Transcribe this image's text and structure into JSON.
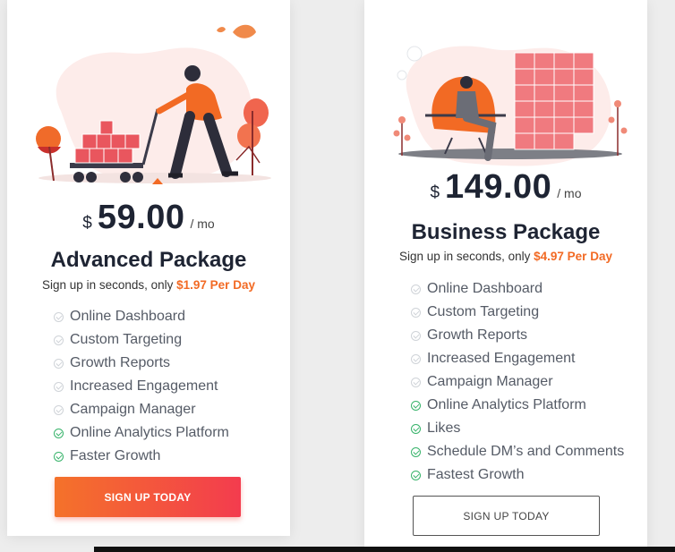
{
  "colors": {
    "accent_orange": "#f26a24",
    "button_gradient_start": "#f4722a",
    "button_gradient_end": "#f33c4e",
    "check_active": "#37b36a",
    "check_inactive": "#cfd3d8",
    "title_dark": "#1e2433"
  },
  "advanced": {
    "illustration": "person-pushing-cart-of-likes-illustration",
    "currency": "$",
    "amount": "59.00",
    "period": "/ mo",
    "title": "Advanced Package",
    "subline_prefix": "Sign up in seconds, only ",
    "subline_highlight": "$1.97 Per Day",
    "features": [
      {
        "label": "Online Dashboard",
        "included": false
      },
      {
        "label": "Custom Targeting",
        "included": false
      },
      {
        "label": "Growth Reports",
        "included": false
      },
      {
        "label": "Increased Engagement",
        "included": false
      },
      {
        "label": "Campaign Manager",
        "included": false
      },
      {
        "label": "Online Analytics Platform",
        "included": true
      },
      {
        "label": "Faster Growth",
        "included": true
      }
    ],
    "button_label": "SIGN UP TODAY"
  },
  "business": {
    "illustration": "person-in-chair-with-follower-stack-illustration",
    "currency": "$",
    "amount": "149.00",
    "period": "/ mo",
    "title": "Business Package",
    "subline_prefix": "Sign up in seconds, only ",
    "subline_highlight": "$4.97 Per Day",
    "features": [
      {
        "label": "Online Dashboard",
        "included": false
      },
      {
        "label": "Custom Targeting",
        "included": false
      },
      {
        "label": "Growth Reports",
        "included": false
      },
      {
        "label": "Increased Engagement",
        "included": false
      },
      {
        "label": "Campaign Manager",
        "included": false
      },
      {
        "label": "Online Analytics Platform",
        "included": true
      },
      {
        "label": "Likes",
        "included": true
      },
      {
        "label": "Schedule DM’s and Comments",
        "included": true
      },
      {
        "label": "Fastest Growth",
        "included": true
      }
    ],
    "button_label": "SIGN UP TODAY"
  }
}
